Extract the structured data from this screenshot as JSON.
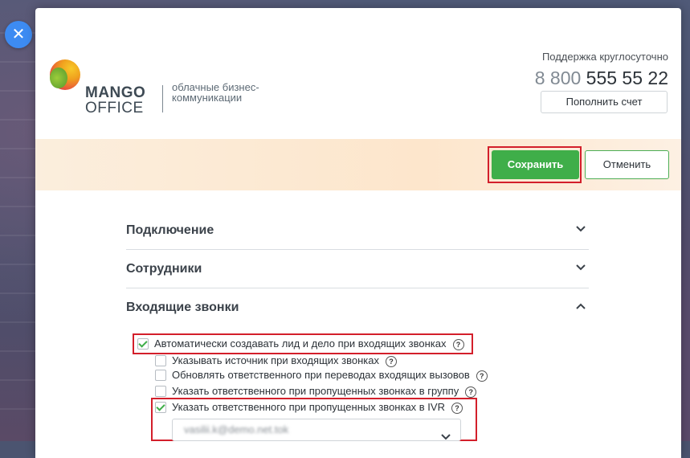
{
  "close_icon": "close-icon",
  "logo": {
    "brand_line1": "MANGO",
    "brand_line2": "OFFICE",
    "tagline": "облачные бизнес-коммуникации"
  },
  "support": {
    "label": "Поддержка круглосуточно",
    "phone_prefix": "8 800",
    "phone_number": "555 55 22",
    "topup_label": "Пополнить счет"
  },
  "actions": {
    "save_label": "Сохранить",
    "cancel_label": "Отменить",
    "accent": "#3fae49",
    "highlight": "#d31f2b"
  },
  "sections": [
    {
      "title": "Подключение",
      "expanded": false
    },
    {
      "title": "Сотрудники",
      "expanded": false
    },
    {
      "title": "Входящие звонки",
      "expanded": true
    }
  ],
  "options": [
    {
      "label": "Автоматически создавать лид и дело при входящих звонках",
      "checked": true
    },
    {
      "label": "Указывать источник при входящих звонках",
      "checked": false
    },
    {
      "label": "Обновлять ответственного при переводах входящих вызовов",
      "checked": false
    },
    {
      "label": "Указать ответственного при пропущенных звонках в группу",
      "checked": false
    },
    {
      "label": "Указать ответственного при пропущенных звонках в IVR",
      "checked": true
    }
  ],
  "ivr_select": {
    "value": "vasilii.k@demo.net.tok"
  }
}
